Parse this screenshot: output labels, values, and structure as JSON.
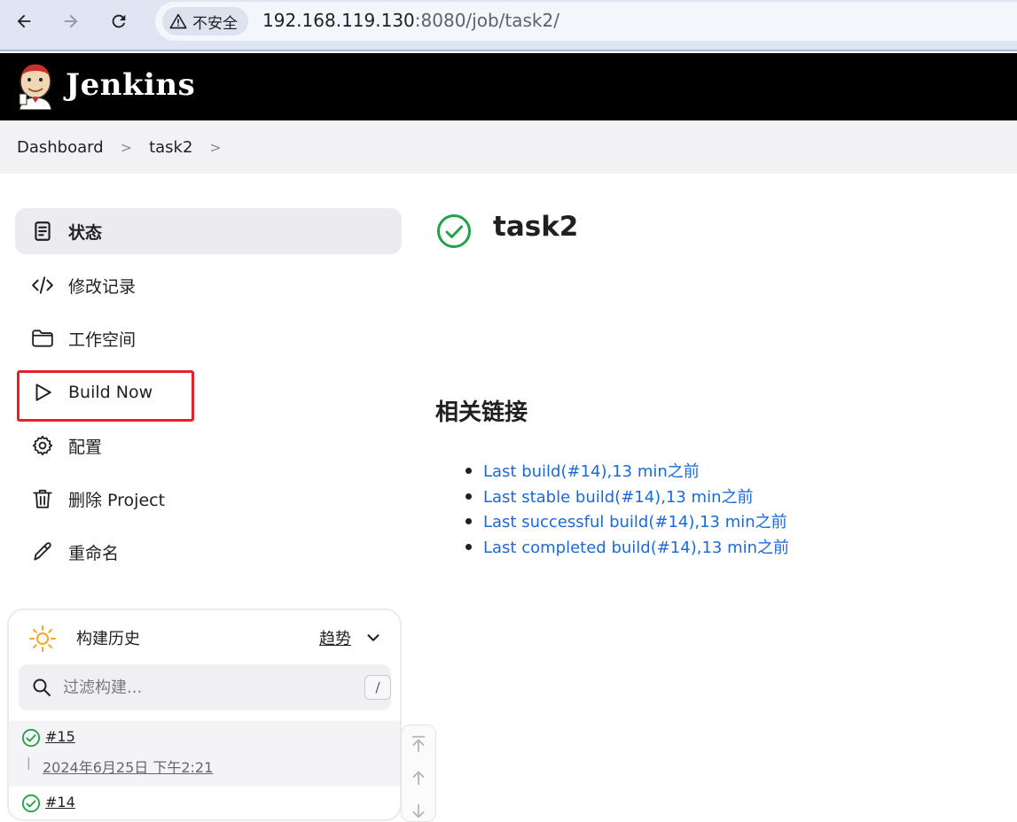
{
  "browser": {
    "security_label": "不安全",
    "url_host": "192.168.119.130",
    "url_rest": ":8080/job/task2/"
  },
  "header": {
    "title": "Jenkins"
  },
  "breadcrumb": {
    "items": [
      "Dashboard",
      "task2"
    ]
  },
  "sidebar": {
    "items": [
      {
        "label": "状态",
        "icon": "document-icon",
        "active": true
      },
      {
        "label": "修改记录",
        "icon": "code-icon",
        "active": false
      },
      {
        "label": "工作空间",
        "icon": "folder-icon",
        "active": false
      },
      {
        "label": "Build Now",
        "icon": "play-icon",
        "active": false
      },
      {
        "label": "配置",
        "icon": "gear-icon",
        "active": false
      },
      {
        "label": "删除 Project",
        "icon": "trash-icon",
        "active": false
      },
      {
        "label": "重命名",
        "icon": "pencil-icon",
        "active": false
      }
    ]
  },
  "build_history": {
    "title": "构建历史",
    "trend_label": "趋势",
    "search_placeholder": "过滤构建...",
    "shortcut": "/",
    "builds": [
      {
        "number": "#15",
        "date": "2024年6月25日 下午2:21",
        "status": "success"
      },
      {
        "number": "#14",
        "status": "success"
      }
    ]
  },
  "main": {
    "job_title": "task2",
    "related_title": "相关链接",
    "links": [
      "Last build(#14),13 min之前",
      "Last stable build(#14),13 min之前",
      "Last successful build(#14),13 min之前",
      "Last completed build(#14),13 min之前"
    ]
  },
  "colors": {
    "success": "#1ea446",
    "link": "#1a6ad8",
    "highlight": "#e8202b",
    "header_bg": "#000000"
  }
}
